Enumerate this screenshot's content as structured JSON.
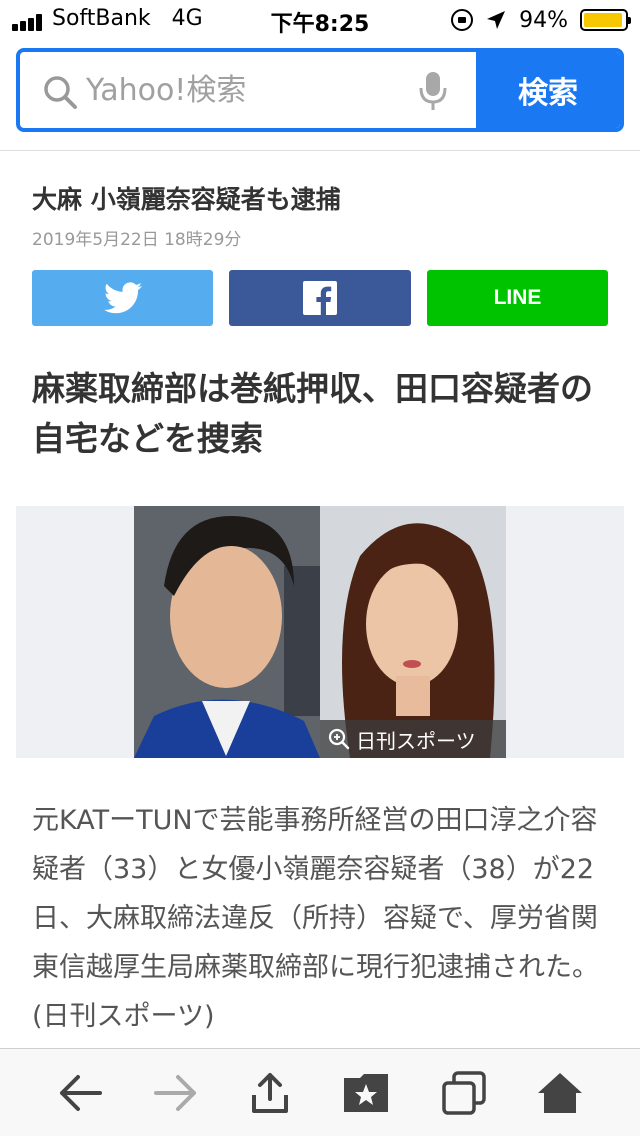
{
  "status_bar": {
    "carrier": "SoftBank",
    "network": "4G",
    "time": "下午8:25",
    "battery_percent": "94%",
    "battery_level": 0.94,
    "battery_color": "#f7c800"
  },
  "search": {
    "placeholder": "Yahoo!検索",
    "value": "",
    "button_label": "検索",
    "accent_color": "#1a78f2"
  },
  "article": {
    "topic_title": "大麻 小嶺麗奈容疑者も逮捕",
    "date": "2019年5月22日 18時29分",
    "headline": "麻薬取締部は巻紙押収、田口容疑者の自宅などを捜索",
    "photo_credit": "日刊スポーツ",
    "body": "元KATーTUNで芸能事務所経営の田口淳之介容疑者（33）と女優小嶺麗奈容疑者（38）が22日、大麻取締法違反（所持）容疑で、厚労省関東信越厚生局麻薬取締部に現行犯逮捕された。(日刊スポーツ)"
  },
  "share": {
    "twitter_icon": "twitter-bird-icon",
    "facebook_icon": "facebook-f-icon",
    "line_label": "LINE",
    "colors": {
      "twitter": "#55acee",
      "facebook": "#3b5998",
      "line": "#00c300"
    }
  },
  "toolbar": {
    "items": [
      "back-arrow-icon",
      "forward-arrow-icon",
      "share-icon",
      "bookmarks-icon",
      "tabs-icon",
      "home-icon"
    ]
  }
}
